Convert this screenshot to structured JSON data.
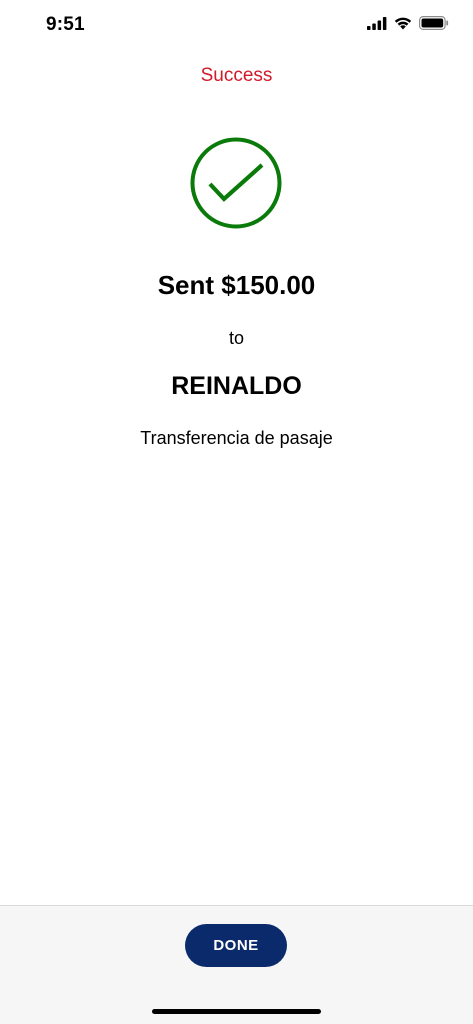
{
  "status_bar": {
    "time": "9:51",
    "icons": [
      "cellular-signal-icon",
      "wifi-icon",
      "battery-icon"
    ]
  },
  "header": {
    "title": "Success",
    "title_color": "#d11a2a"
  },
  "confirmation": {
    "icon": "checkmark-circle-icon",
    "icon_color": "#0a7a0a",
    "amount_text": "Sent $150.00",
    "to_text": "to",
    "recipient": "REINALDO",
    "memo": "Transferencia de pasaje"
  },
  "footer": {
    "done_label": "DONE",
    "button_color": "#0b2a6b"
  }
}
